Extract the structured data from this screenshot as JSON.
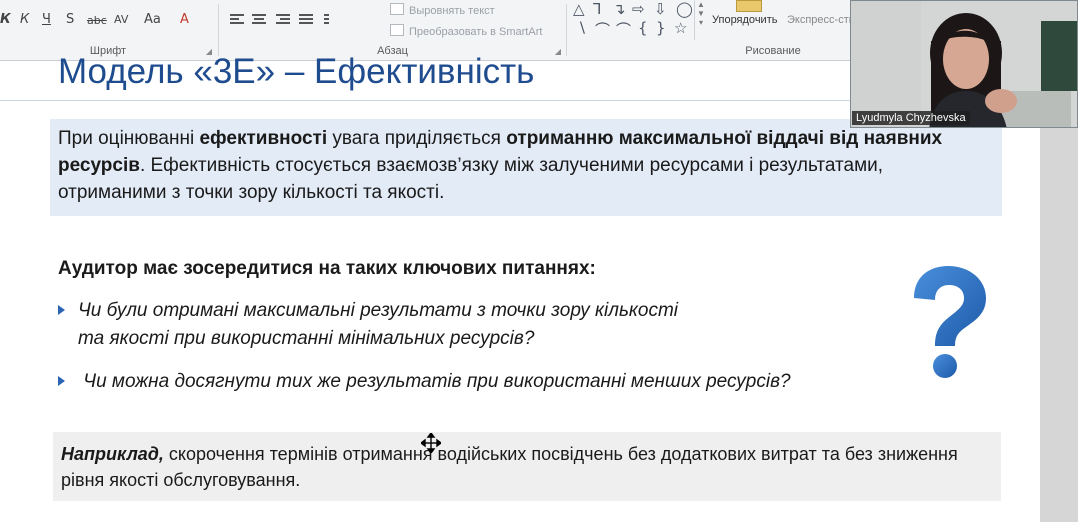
{
  "ribbon": {
    "font_group": {
      "label": "Шрифт",
      "buttons": [
        "К",
        "К",
        "Ч",
        "S",
        "abc",
        "AV",
        "Aa",
        "A"
      ]
    },
    "paragraph_group": {
      "label": "Абзац",
      "align_text": "Выровнять текст",
      "convert_smartart": "Преобразовать в SmartArt"
    },
    "drawing_group": {
      "label": "Рисование",
      "arrange": "Упорядочить",
      "express_styles": "Экспресс-сти"
    }
  },
  "slide": {
    "title": "Модель «3E» – Ефективність",
    "intro": {
      "p1": "При оцінюванні ",
      "b1": "ефективності",
      "p2": " увага приділяється ",
      "b2": "отриманню максимальної віддачі від наявних ресурсів",
      "p3": ". Ефективність стосується взаємозв’язку між залученими ресурсами і результатами, отриманими з точки зору кількості та якості."
    },
    "questions_heading": "Аудитор має зосередитися на таких ключових питаннях:",
    "questions": [
      {
        "line1": "Чи були отримані максимальні результати з точки зору кількості",
        "line2": "та якості при використанні мінімальних ресурсів?"
      },
      {
        "line1": " Чи можна досягнути тих же результатів при використанні менших ресурсів?"
      }
    ],
    "example": {
      "lead": "Наприклад,",
      "text": " скорочення термінів отримання водійських посвідчень без додаткових витрат та без зниження рівня якості обслуговування."
    }
  },
  "video": {
    "participant_name": "Lyudmyla Chyzhevska"
  },
  "colors": {
    "title": "#1f4c8f",
    "intro_box": "#e3ebf7",
    "example_box": "#efefef",
    "question_mark": "#2b6fc0",
    "bullet": "#2a64b2"
  },
  "icons": [
    "question-mark-icon",
    "move-cursor-icon",
    "bullet-arrow-icon"
  ]
}
